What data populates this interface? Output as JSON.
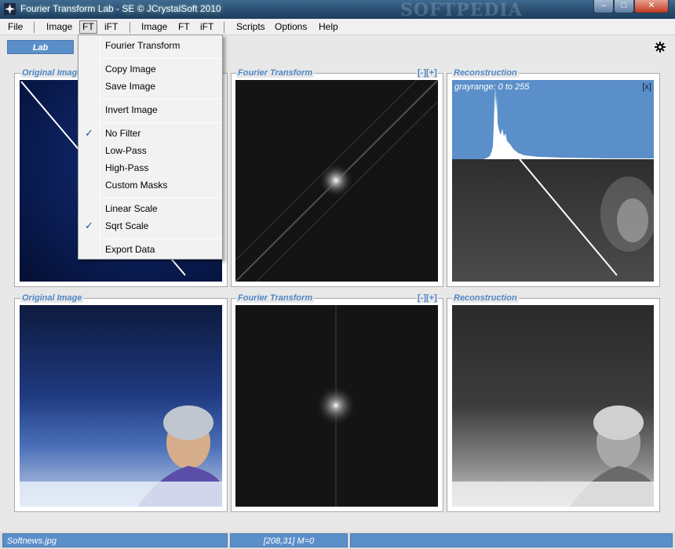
{
  "window": {
    "title": "Fourier Transform Lab - SE  © JCrystalSoft 2010",
    "watermark": "SOFTPEDIA",
    "minimize_glyph": "–",
    "maximize_glyph": "□",
    "close_glyph": "✕"
  },
  "menubar": {
    "items": [
      "File",
      "|",
      "Image",
      "FT",
      "iFT",
      "|",
      "Image",
      "FT",
      "iFT",
      "|",
      "Scripts",
      "Options",
      "Help"
    ],
    "active": "FT"
  },
  "toolbar": {
    "tab_label": "Lab",
    "settings_icon": "gear-icon"
  },
  "panels": {
    "top": {
      "original_label": "Original Image",
      "ft_label": "Fourier Transform",
      "ft_controls": "[-][+]",
      "recon_label": "Reconstruction",
      "gray_range": "grayrange: 0 to 255",
      "gray_close": "[x]"
    },
    "bottom": {
      "original_label": "Original Image",
      "ft_label": "Fourier Transform",
      "ft_controls": "[-][+]",
      "recon_label": "Reconstruction"
    }
  },
  "ft_menu": {
    "items": [
      {
        "label": "Fourier Transform",
        "checked": false
      },
      {
        "label": "Copy Image",
        "checked": false
      },
      {
        "label": "Save Image",
        "checked": false
      },
      {
        "label": "Invert Image",
        "checked": false
      },
      {
        "label": "No Filter",
        "checked": true
      },
      {
        "label": "Low-Pass",
        "checked": false
      },
      {
        "label": "High-Pass",
        "checked": false
      },
      {
        "label": "Custom Masks",
        "checked": false
      },
      {
        "label": "Linear Scale",
        "checked": false
      },
      {
        "label": "Sqrt Scale",
        "checked": true
      },
      {
        "label": "Export Data",
        "checked": false
      }
    ],
    "check_glyph": "✓"
  },
  "statusbar": {
    "file": "Softnews.jpg",
    "coords": "[208,31]  M=0"
  },
  "colors": {
    "accent": "#5b8fc9",
    "label": "#4f87c2",
    "histogram_bg": "#5b8fc9"
  }
}
